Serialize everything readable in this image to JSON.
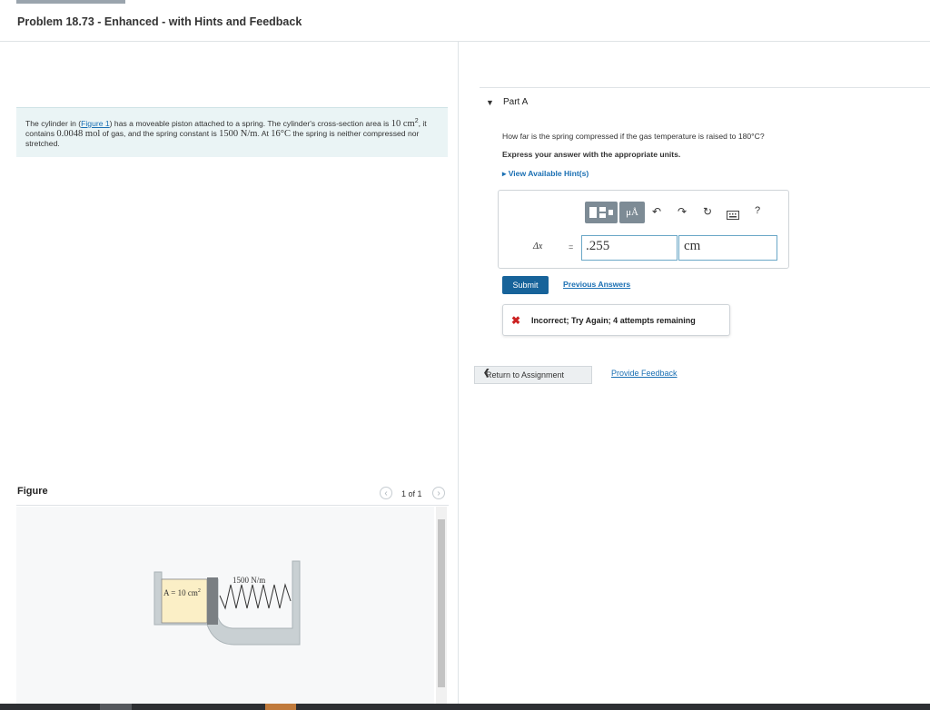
{
  "header": {
    "title": "Problem 18.73 - Enhanced - with Hints and Feedback"
  },
  "problem": {
    "part1": "The cylinder in (",
    "figure_link": "Figure 1",
    "part2": ") has a moveable piston attached to a spring. The cylinder's cross-section area is",
    "area": "10 cm",
    "area_exp": "2",
    "part3": ", it contains ",
    "moles": "0.0048 mol",
    "part4": " of gas, and the spring constant is ",
    "spring_k": "1500 N/m",
    "part5": ". At ",
    "temp": "16°C",
    "part6": " the spring is neither compressed nor stretched."
  },
  "figure_panel": {
    "label": "Figure",
    "pager": "1 of 1",
    "prev_icon": "‹",
    "next_icon": "›",
    "figure": {
      "area_label": "A = 10 cm",
      "area_exp": "2",
      "spring_label": "1500 N/m"
    }
  },
  "part_a": {
    "caret": "▼",
    "label": "Part A",
    "question": "How far is the spring compressed if the gas temperature is raised to 180°C?",
    "instruction": "Express your answer with the appropriate units.",
    "hints_link": "▸ View Available Hint(s)",
    "toolbar": {
      "mu_label": "μÅ",
      "undo_icon": "↶",
      "redo_icon": "↷",
      "reset_icon": "↻",
      "help_icon": "?"
    },
    "variable_label": "Δx",
    "equals": "=",
    "value": ".255",
    "unit": "cm",
    "submit_label": "Submit",
    "previous_answers": "Previous Answers",
    "feedback": {
      "icon": "✖",
      "text": "Incorrect; Try Again; 4 attempts remaining"
    }
  },
  "footer": {
    "return_label": "Return to Assignment",
    "return_chevron": "❮",
    "provide_feedback": "Provide Feedback"
  },
  "colors": {
    "accent": "#17639a",
    "link": "#1a6fb3",
    "error": "#cc2222",
    "problem_bg": "#eaf4f5"
  }
}
